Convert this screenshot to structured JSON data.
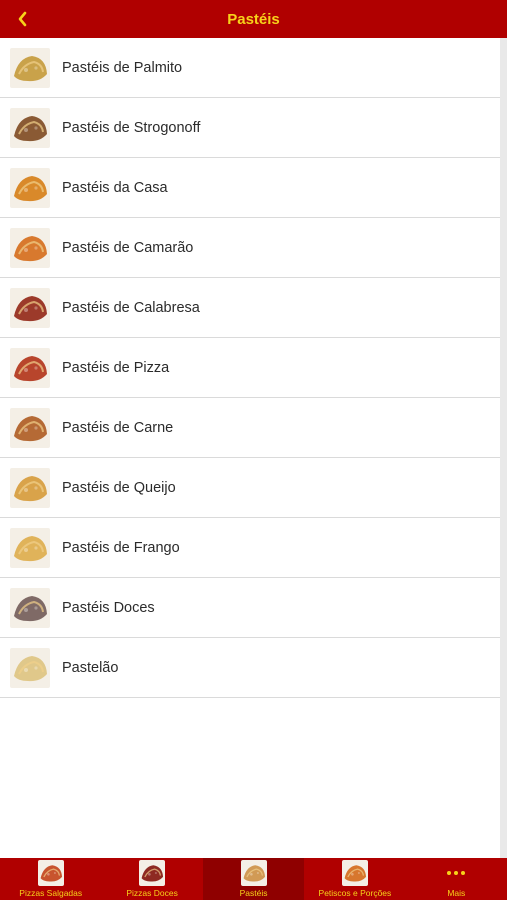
{
  "header": {
    "title": "Pastéis",
    "back_icon": "chevron-left-icon",
    "background": "#b00000",
    "title_color": "#f7d21a"
  },
  "list": {
    "items": [
      {
        "label": "Pastéis de Palmito",
        "thumb_color": "#c9a24a"
      },
      {
        "label": "Pastéis de Strogonoff",
        "thumb_color": "#8a5a34"
      },
      {
        "label": "Pastéis da Casa",
        "thumb_color": "#d9892a"
      },
      {
        "label": "Pastéis de Camarão",
        "thumb_color": "#d8792e"
      },
      {
        "label": "Pastéis de Calabresa",
        "thumb_color": "#9c3a2a"
      },
      {
        "label": "Pastéis de Pizza",
        "thumb_color": "#b8452c"
      },
      {
        "label": "Pastéis de Carne",
        "thumb_color": "#b56a35"
      },
      {
        "label": "Pastéis de Queijo",
        "thumb_color": "#d9a34a"
      },
      {
        "label": "Pastéis de Frango",
        "thumb_color": "#e0b35a"
      },
      {
        "label": "Pastéis Doces",
        "thumb_color": "#7f6a66"
      },
      {
        "label": "Pastelão",
        "thumb_color": "#e0c88a"
      }
    ]
  },
  "tabbar": {
    "tabs": [
      {
        "label": "Pizzas Salgadas",
        "active": false,
        "color": "#c8542e"
      },
      {
        "label": "Pizzas Doces",
        "active": false,
        "color": "#8e2a22"
      },
      {
        "label": "Pastéis",
        "active": true,
        "color": "#d19a55"
      },
      {
        "label": "Petiscos e Porções",
        "active": false,
        "color": "#d7772e"
      },
      {
        "label": "Mais",
        "active": false,
        "icon": "more-icon"
      }
    ]
  }
}
